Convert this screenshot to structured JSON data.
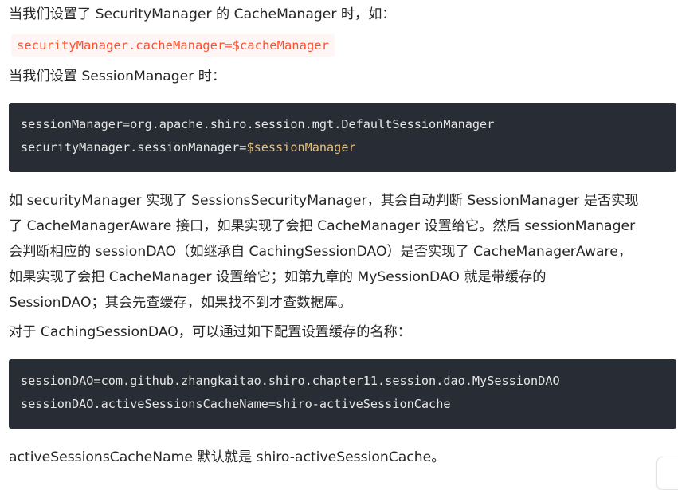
{
  "intro_cache": "当我们设置了 SecurityManager 的 CacheManager 时，如：",
  "inline_code": "securityManager.cacheManager=$cacheManager",
  "intro_session": "当我们设置 SessionManager 时：",
  "code_block_1": {
    "line1": "sessionManager=org.apache.shiro.session.mgt.DefaultSessionManager",
    "line2_prefix": "securityManager.sessionManager=",
    "line2_var": "$sessionManager"
  },
  "paragraph": {
    "line1": "如 securityManager 实现了 SessionsSecurityManager，其会自动判断 SessionManager 是否实现",
    "line2": "了 CacheManagerAware 接口，如果实现了会把 CacheManager 设置给它。然后 sessionManager",
    "line3": "会判断相应的 sessionDAO（如继承自 CachingSessionDAO）是否实现了 CacheManagerAware，",
    "line4": "如果实现了会把 CacheManager 设置给它；如第九章的 MySessionDAO 就是带缓存的",
    "line5": "SessionDAO；其会先查缓存，如果找不到才查数据库。"
  },
  "intro_caching_dao": "对于 CachingSessionDAO，可以通过如下配置设置缓存的名称：",
  "code_block_2": {
    "line1": "sessionDAO=com.github.zhangkaitao.shiro.chapter11.session.dao.MySessionDAO",
    "line2": "sessionDAO.activeSessionsCacheName=shiro-activeSessionCache"
  },
  "closing": "activeSessionsCacheName 默认就是 shiro-activeSessionCache。",
  "colors": {
    "code_background": "#282c34",
    "inline_code_text": "#ff502c",
    "variable_highlight": "#e6c07b"
  }
}
